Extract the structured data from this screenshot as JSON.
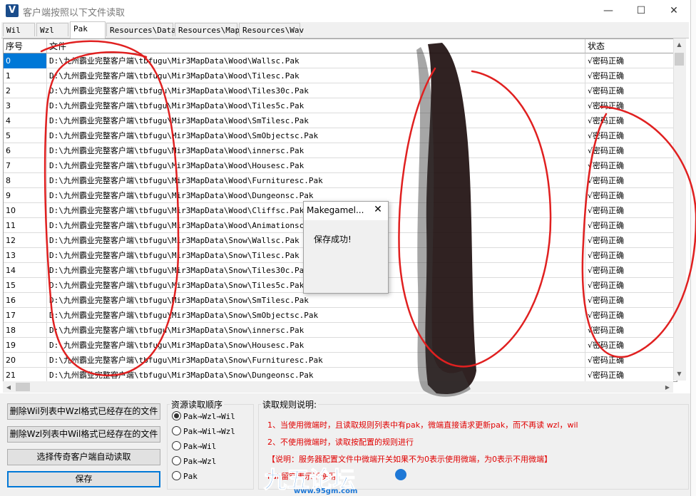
{
  "window": {
    "title": "客户端按照以下文件读取",
    "minimize_glyph": "—",
    "maximize_glyph": "☐",
    "close_glyph": "✕"
  },
  "tabs": [
    {
      "label": "Wil"
    },
    {
      "label": "Wzl"
    },
    {
      "label": "Pak"
    },
    {
      "label": "Resources\\Data"
    },
    {
      "label": "Resources\\Map"
    },
    {
      "label": "Resources\\Wav"
    }
  ],
  "grid": {
    "headers": {
      "index": "序号",
      "file": "文件",
      "status": "状态"
    },
    "rows": [
      {
        "index": "0",
        "file": "D:\\九州霸业完整客户端\\tbfugu\\Mir3MapData\\Wood\\Wallsc.Pak",
        "status": "√密码正确"
      },
      {
        "index": "1",
        "file": "D:\\九州霸业完整客户端\\tbfugu\\Mir3MapData\\Wood\\Tilesc.Pak",
        "status": "√密码正确"
      },
      {
        "index": "2",
        "file": "D:\\九州霸业完整客户端\\tbfugu\\Mir3MapData\\Wood\\Tiles30c.Pak",
        "status": "√密码正确"
      },
      {
        "index": "3",
        "file": "D:\\九州霸业完整客户端\\tbfugu\\Mir3MapData\\Wood\\Tiles5c.Pak",
        "status": "√密码正确"
      },
      {
        "index": "4",
        "file": "D:\\九州霸业完整客户端\\tbfugu\\Mir3MapData\\Wood\\SmTilesc.Pak",
        "status": "√密码正确"
      },
      {
        "index": "5",
        "file": "D:\\九州霸业完整客户端\\tbfugu\\Mir3MapData\\Wood\\SmObjectsc.Pak",
        "status": "√密码正确"
      },
      {
        "index": "6",
        "file": "D:\\九州霸业完整客户端\\tbfugu\\Mir3MapData\\Wood\\innersc.Pak",
        "status": "√密码正确"
      },
      {
        "index": "7",
        "file": "D:\\九州霸业完整客户端\\tbfugu\\Mir3MapData\\Wood\\Housesc.Pak",
        "status": "√密码正确"
      },
      {
        "index": "8",
        "file": "D:\\九州霸业完整客户端\\tbfugu\\Mir3MapData\\Wood\\Furnituresc.Pak",
        "status": "√密码正确"
      },
      {
        "index": "9",
        "file": "D:\\九州霸业完整客户端\\tbfugu\\Mir3MapData\\Wood\\Dungeonsc.Pak",
        "status": "√密码正确"
      },
      {
        "index": "10",
        "file": "D:\\九州霸业完整客户端\\tbfugu\\Mir3MapData\\Wood\\Cliffsc.Pak",
        "status": "√密码正确"
      },
      {
        "index": "11",
        "file": "D:\\九州霸业完整客户端\\tbfugu\\Mir3MapData\\Wood\\Animationsc.Pak",
        "status": "√密码正确"
      },
      {
        "index": "12",
        "file": "D:\\九州霸业完整客户端\\tbfugu\\Mir3MapData\\Snow\\Wallsc.Pak",
        "status": "√密码正确"
      },
      {
        "index": "13",
        "file": "D:\\九州霸业完整客户端\\tbfugu\\Mir3MapData\\Snow\\Tilesc.Pak",
        "status": "√密码正确"
      },
      {
        "index": "14",
        "file": "D:\\九州霸业完整客户端\\tbfugu\\Mir3MapData\\Snow\\Tiles30c.Pak",
        "status": "√密码正确"
      },
      {
        "index": "15",
        "file": "D:\\九州霸业完整客户端\\tbfugu\\Mir3MapData\\Snow\\Tiles5c.Pak",
        "status": "√密码正确"
      },
      {
        "index": "16",
        "file": "D:\\九州霸业完整客户端\\tbfugu\\Mir3MapData\\Snow\\SmTilesc.Pak",
        "status": "√密码正确"
      },
      {
        "index": "17",
        "file": "D:\\九州霸业完整客户端\\tbfugu\\Mir3MapData\\Snow\\SmObjectsc.Pak",
        "status": "√密码正确"
      },
      {
        "index": "18",
        "file": "D:\\九州霸业完整客户端\\tbfugu\\Mir3MapData\\Snow\\innersc.Pak",
        "status": "√密码正确"
      },
      {
        "index": "19",
        "file": "D:\\九州霸业完整客户端\\tbfugu\\Mir3MapData\\Snow\\Housesc.Pak",
        "status": "√密码正确"
      },
      {
        "index": "20",
        "file": "D:\\九州霸业完整客户端\\tbfugu\\Mir3MapData\\Snow\\Furnituresc.Pak",
        "status": "√密码正确"
      },
      {
        "index": "21",
        "file": "D:\\九州霸业完整客户端\\tbfugu\\Mir3MapData\\Snow\\Dungeonsc.Pak",
        "status": "√密码正确"
      }
    ]
  },
  "buttons": {
    "delete_wil": "删除Wil列表中Wzl格式已经存在的文件",
    "delete_wzl": "删除Wzl列表中Wil格式已经存在的文件",
    "auto_read": "选择传奇客户端自动读取",
    "save": "保存"
  },
  "order_group": {
    "title": "资源读取顺序",
    "options": [
      {
        "label": "Pak→Wzl→Wil",
        "selected": true
      },
      {
        "label": "Pak→Wil→Wzl",
        "selected": false
      },
      {
        "label": "Pak→Wil",
        "selected": false
      },
      {
        "label": "Pak→Wzl",
        "selected": false
      },
      {
        "label": "Pak",
        "selected": false
      }
    ]
  },
  "rules_group": {
    "title": "读取规则说明:",
    "lines": [
      "1、当使用微端时，且读取规则列表中有pak，微端直接请求更新pak，而不再读 wzl，wil",
      "2、不使用微端时，读取按配置的规则进行",
      "【说明：服务器配置文件中微端开关如果不为0表示使用微端，为0表示不用微端】",
      "Pak留空表示不使用"
    ]
  },
  "dialog": {
    "title": "Makegamel...",
    "message": "保存成功!",
    "close_glyph": "✕"
  },
  "watermark": {
    "brand": "九五论坛",
    "url": "www.95gm.com"
  },
  "colors": {
    "selection": "#0078d7",
    "rule_text": "#e00000",
    "annotation": "#e02020",
    "watermark": "#1e78d6"
  }
}
